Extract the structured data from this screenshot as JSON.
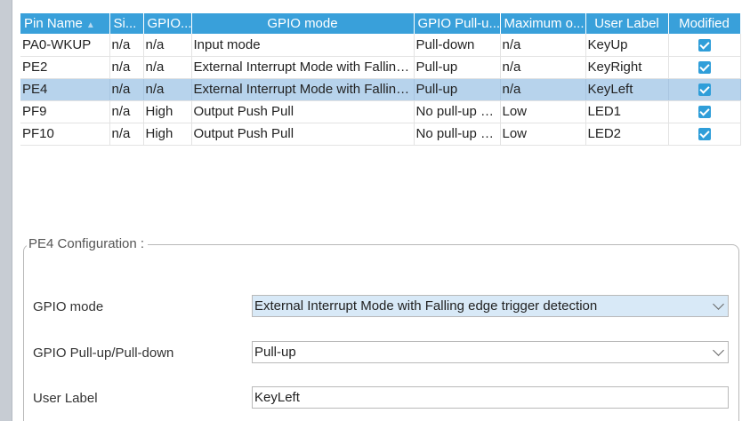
{
  "table": {
    "columns": [
      "Pin Name",
      "Si...",
      "GPIO...",
      "GPIO mode",
      "GPIO Pull-u...",
      "Maximum o...",
      "User Label",
      "Modified"
    ],
    "rows": [
      {
        "pin": "PA0-WKUP",
        "si": "n/a",
        "gpio": "n/a",
        "mode": "Input mode",
        "pull": "Pull-down",
        "max": "n/a",
        "label": "KeyUp",
        "modified": true
      },
      {
        "pin": "PE2",
        "si": "n/a",
        "gpio": "n/a",
        "mode": "External Interrupt Mode with Falling...",
        "pull": "Pull-up",
        "max": "n/a",
        "label": "KeyRight",
        "modified": true
      },
      {
        "pin": "PE4",
        "si": "n/a",
        "gpio": "n/a",
        "mode": "External Interrupt Mode with Falling...",
        "pull": "Pull-up",
        "max": "n/a",
        "label": "KeyLeft",
        "modified": true
      },
      {
        "pin": "PF9",
        "si": "n/a",
        "gpio": "High",
        "mode": "Output Push Pull",
        "pull": "No pull-up a...",
        "max": "Low",
        "label": "LED1",
        "modified": true
      },
      {
        "pin": "PF10",
        "si": "n/a",
        "gpio": "High",
        "mode": "Output Push Pull",
        "pull": "No pull-up a...",
        "max": "Low",
        "label": "LED2",
        "modified": true
      }
    ],
    "selected_row": "PE4"
  },
  "config": {
    "title": "PE4 Configuration :",
    "gpio_mode_label": "GPIO mode",
    "gpio_mode_value": "External Interrupt Mode with Falling edge trigger detection",
    "pull_label": "GPIO Pull-up/Pull-down",
    "pull_value": "Pull-up",
    "user_label_label": "User Label",
    "user_label_value": "KeyLeft"
  },
  "colors": {
    "header": "#39a0da",
    "selected_row": "#b7d3ec",
    "checkbox": "#2f9ed9"
  }
}
